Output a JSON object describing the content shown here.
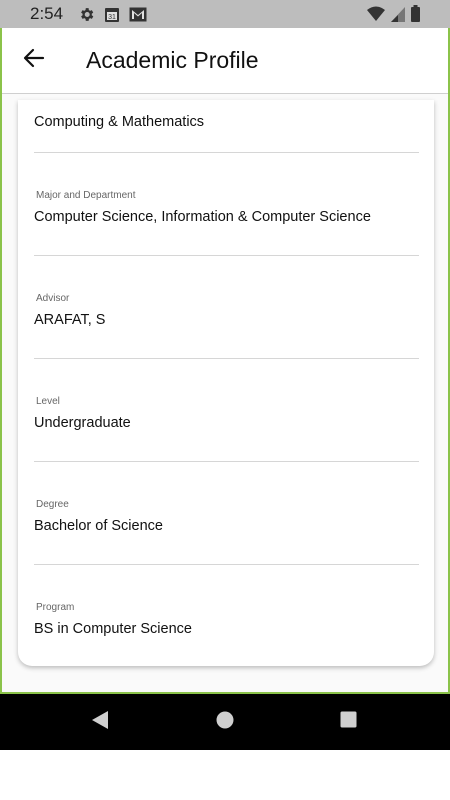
{
  "status_bar": {
    "time": "2:54",
    "icons": [
      "gear-icon",
      "calendar-icon",
      "gmail-icon",
      "wifi-icon",
      "signal-icon",
      "battery-icon"
    ],
    "calendar_day": "31"
  },
  "app_bar": {
    "title": "Academic Profile",
    "back_icon": "arrow-back-icon"
  },
  "profile": {
    "college_value": "Computing & Mathematics",
    "major_label": "Major and Department",
    "major_value": "Computer Science, Information & Computer Science",
    "advisor_label": "Advisor",
    "advisor_value": "ARAFAT, S",
    "level_label": "Level",
    "level_value": "Undergraduate",
    "degree_label": "Degree",
    "degree_value": "Bachelor of Science",
    "program_label": "Program",
    "program_value": "BS in Computer Science"
  },
  "nav_bar": {
    "icons": [
      "back-triangle-icon",
      "home-circle-icon",
      "recents-square-icon"
    ]
  },
  "colors": {
    "status_bar_bg": "#bdbdbd",
    "frame_border": "#8bc34a",
    "nav_bar_bg": "#000000",
    "text_primary": "#111111",
    "text_secondary": "#666666"
  }
}
